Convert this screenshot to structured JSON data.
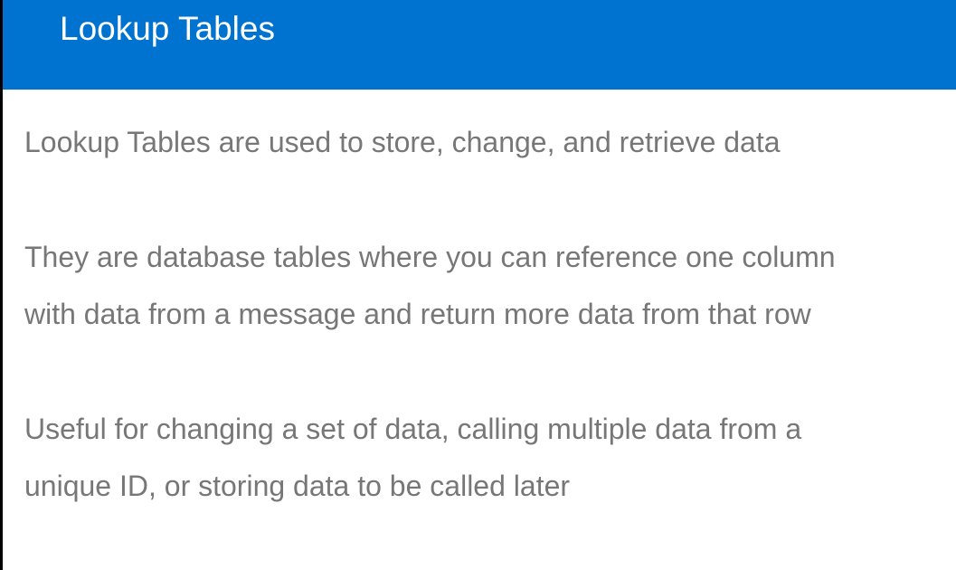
{
  "header": {
    "title": "Lookup Tables"
  },
  "paragraphs": [
    {
      "lines": [
        "Lookup Tables are used to store, change, and retrieve data"
      ]
    },
    {
      "lines": [
        "They are database tables where you can reference one column",
        "with data from a message and return more data from that row"
      ]
    },
    {
      "lines": [
        "Useful for changing a set of data, calling multiple data from a",
        "unique ID, or storing data to be called later"
      ]
    }
  ],
  "colors": {
    "header_bg": "#0073d1",
    "title_text": "#ffffff",
    "body_text": "#777777",
    "left_edge": "#000000"
  }
}
